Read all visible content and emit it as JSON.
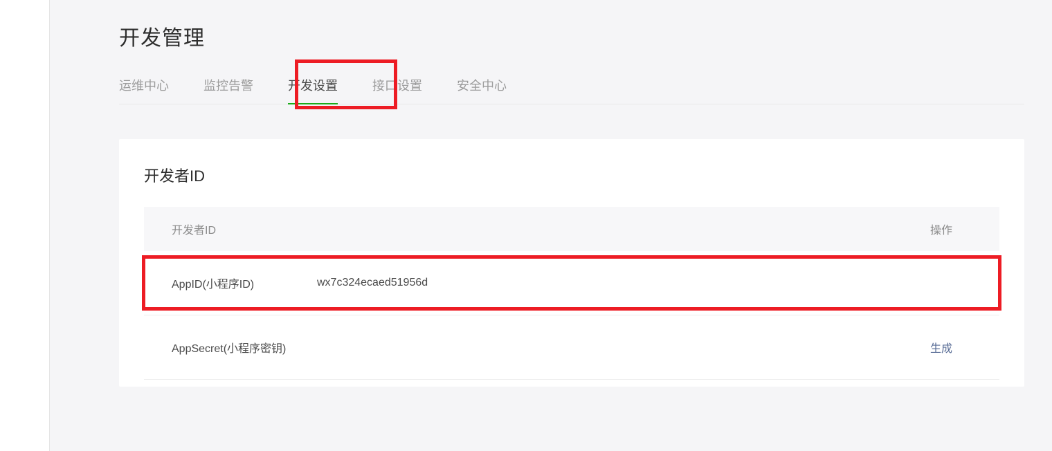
{
  "page": {
    "title": "开发管理"
  },
  "tabs": [
    {
      "label": "运维中心"
    },
    {
      "label": "监控告警"
    },
    {
      "label": "开发设置"
    },
    {
      "label": "接口设置"
    },
    {
      "label": "安全中心"
    }
  ],
  "card": {
    "title": "开发者ID",
    "columns": {
      "id": "开发者ID",
      "action": "操作"
    },
    "rows": [
      {
        "label": "AppID(小程序ID)",
        "value": "wx7c324ecaed51956d",
        "action": ""
      },
      {
        "label": "AppSecret(小程序密钥)",
        "value": "",
        "action": "生成"
      }
    ]
  }
}
